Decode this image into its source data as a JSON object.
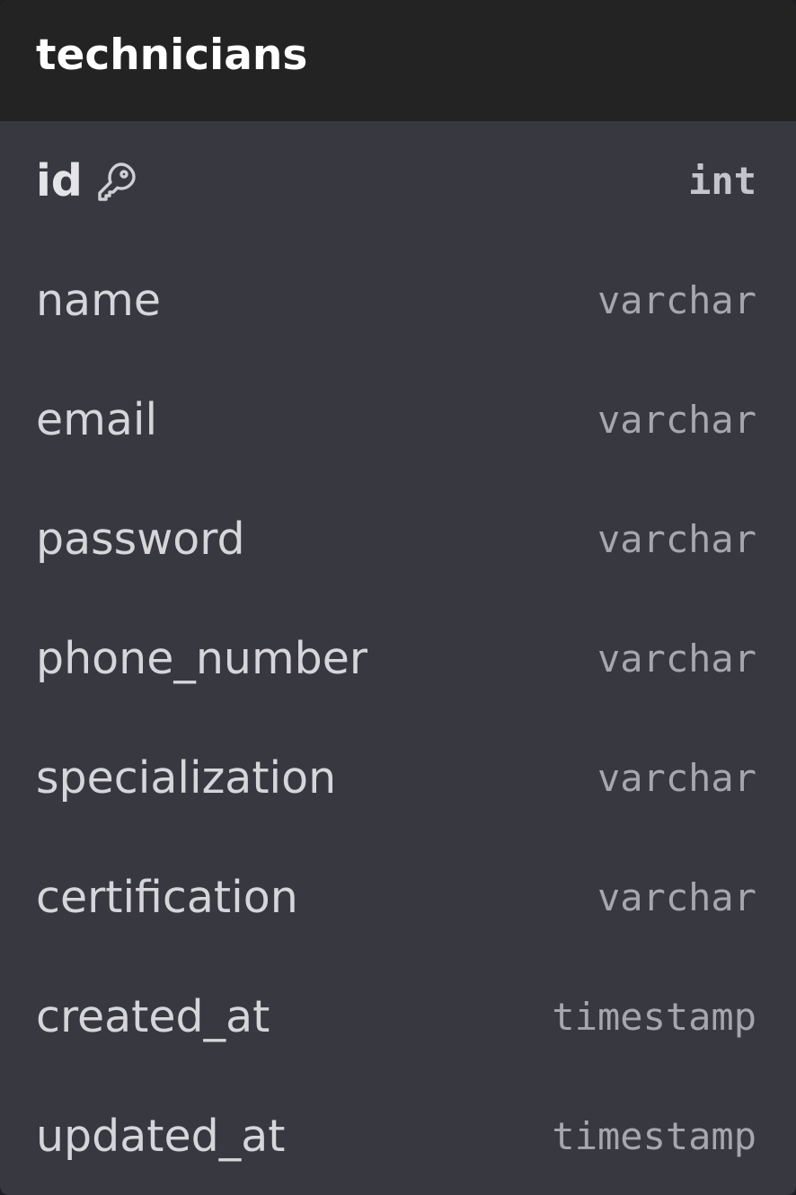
{
  "table": {
    "name": "technicians",
    "columns": [
      {
        "name": "id",
        "type": "int",
        "primary_key": true,
        "icon": "key-icon"
      },
      {
        "name": "name",
        "type": "varchar"
      },
      {
        "name": "email",
        "type": "varchar"
      },
      {
        "name": "password",
        "type": "varchar"
      },
      {
        "name": "phone_number",
        "type": "varchar"
      },
      {
        "name": "specialization",
        "type": "varchar"
      },
      {
        "name": "certification",
        "type": "varchar"
      },
      {
        "name": "created_at",
        "type": "timestamp"
      },
      {
        "name": "updated_at",
        "type": "timestamp"
      }
    ]
  },
  "colors": {
    "header_bg": "#232323",
    "body_bg": "#383940",
    "title_text": "#ffffff",
    "field_text": "#d6d6da",
    "type_text": "#a6a7ad"
  }
}
